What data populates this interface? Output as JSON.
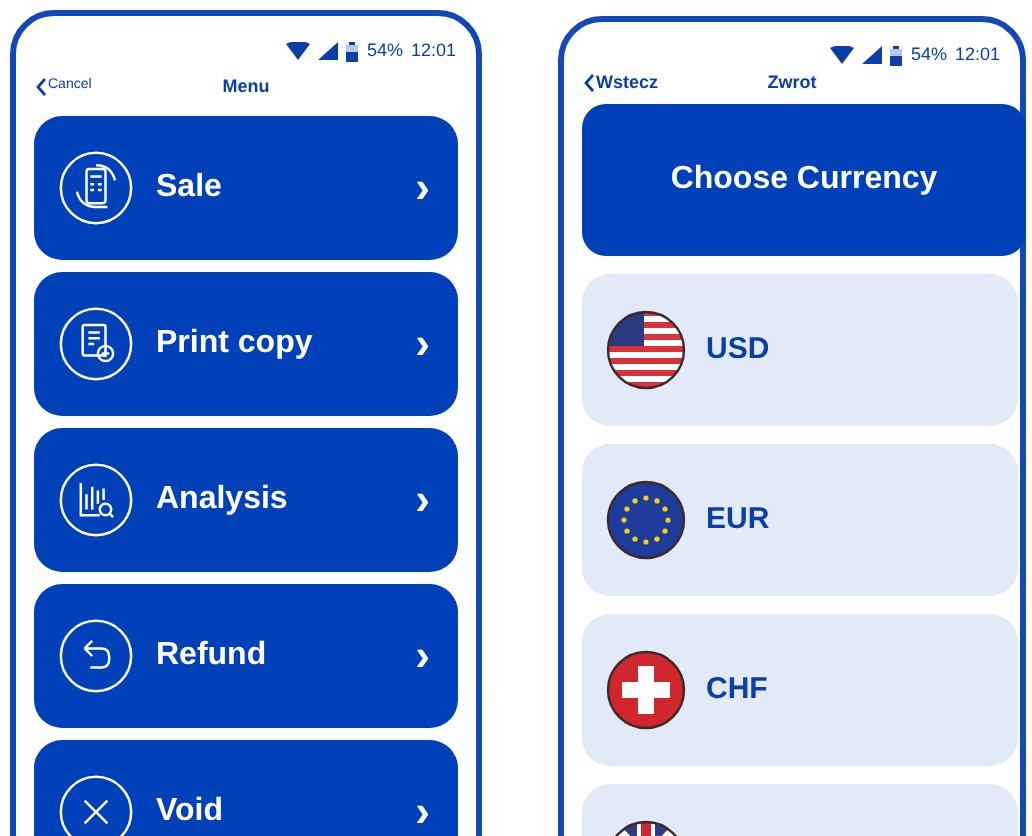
{
  "menu_screen": {
    "status_bar": {
      "battery": "54%",
      "time": "12:01"
    },
    "back": "Cancel",
    "title": "Menu",
    "items": [
      {
        "kind": "sale",
        "label": "Sale",
        "chevron": "›"
      },
      {
        "kind": "print",
        "label": "Print copy",
        "chevron": "›"
      },
      {
        "kind": "analysis",
        "label": "Analysis",
        "chevron": "›"
      },
      {
        "kind": "refund",
        "label": "Refund",
        "chevron": "›"
      },
      {
        "kind": "void",
        "label": "Void",
        "chevron": "›"
      }
    ]
  },
  "currency_screen": {
    "status_bar": {
      "battery": "54%",
      "time": "12:01"
    },
    "back": "Wstecz",
    "title": "Zwrot",
    "heading": "Choose Currency",
    "currencies": [
      {
        "kind": "us",
        "code": "USD"
      },
      {
        "kind": "eu",
        "code": "EUR"
      },
      {
        "kind": "ch",
        "code": "CHF"
      },
      {
        "kind": "gb"
      }
    ]
  }
}
